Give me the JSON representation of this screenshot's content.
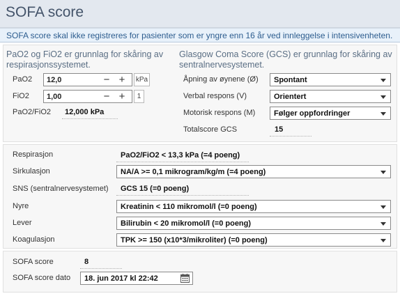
{
  "header": {
    "title": "SOFA score"
  },
  "notice": "SOFA score skal ikke registreres for pasienter som er yngre enn 16 år ved innleggelse i intensivenheten.",
  "resp_section": {
    "heading_line1": "PaO2 og FiO2 er grunnlag for skåring av",
    "heading_line2": "respirasjonssystemet.",
    "pao2": {
      "label": "PaO2",
      "value": "12,0",
      "unit": "kPa"
    },
    "fio2": {
      "label": "FiO2",
      "value": "1,00",
      "unit": "1"
    },
    "ratio": {
      "label": "PaO2/FiO2",
      "value": "12,000 kPa"
    }
  },
  "gcs_section": {
    "heading_line1": "Glasgow Coma Score (GCS) er grunnlag for skåring av",
    "heading_line2": "sentralnervesystemet.",
    "eye": {
      "label": "Åpning av øynene (Ø)",
      "value": "Spontant"
    },
    "verbal": {
      "label": "Verbal respons (V)",
      "value": "Orientert"
    },
    "motor": {
      "label": "Motorisk respons (M)",
      "value": "Følger oppfordringer"
    },
    "total": {
      "label": "Totalscore GCS",
      "value": "15"
    }
  },
  "organs": {
    "resp": {
      "label": "Respirasjon",
      "value": "PaO2/FiO2 < 13,3 kPa (=4 poeng)"
    },
    "circ": {
      "label": "Sirkulasjon",
      "value": "NA/A >= 0,1 mikrogram/kg/m (=4 poeng)"
    },
    "cns": {
      "label": "SNS (sentralnervesystemet)",
      "value": "GCS 15 (=0 poeng)"
    },
    "kidney": {
      "label": "Nyre",
      "value": "Kreatinin < 110 mikromol/l (=0 poeng)"
    },
    "liver": {
      "label": "Lever",
      "value": "Bilirubin < 20 mikromol/l (=0 poeng)"
    },
    "coag": {
      "label": "Koagulasjon",
      "value": "TPK >= 150 (x10*3/mikroliter) (=0 poeng)"
    }
  },
  "summary": {
    "score_label": "SOFA score",
    "score_value": "8",
    "date_label": "SOFA score dato",
    "date_value": "18. jun 2017 kl 22:42"
  }
}
